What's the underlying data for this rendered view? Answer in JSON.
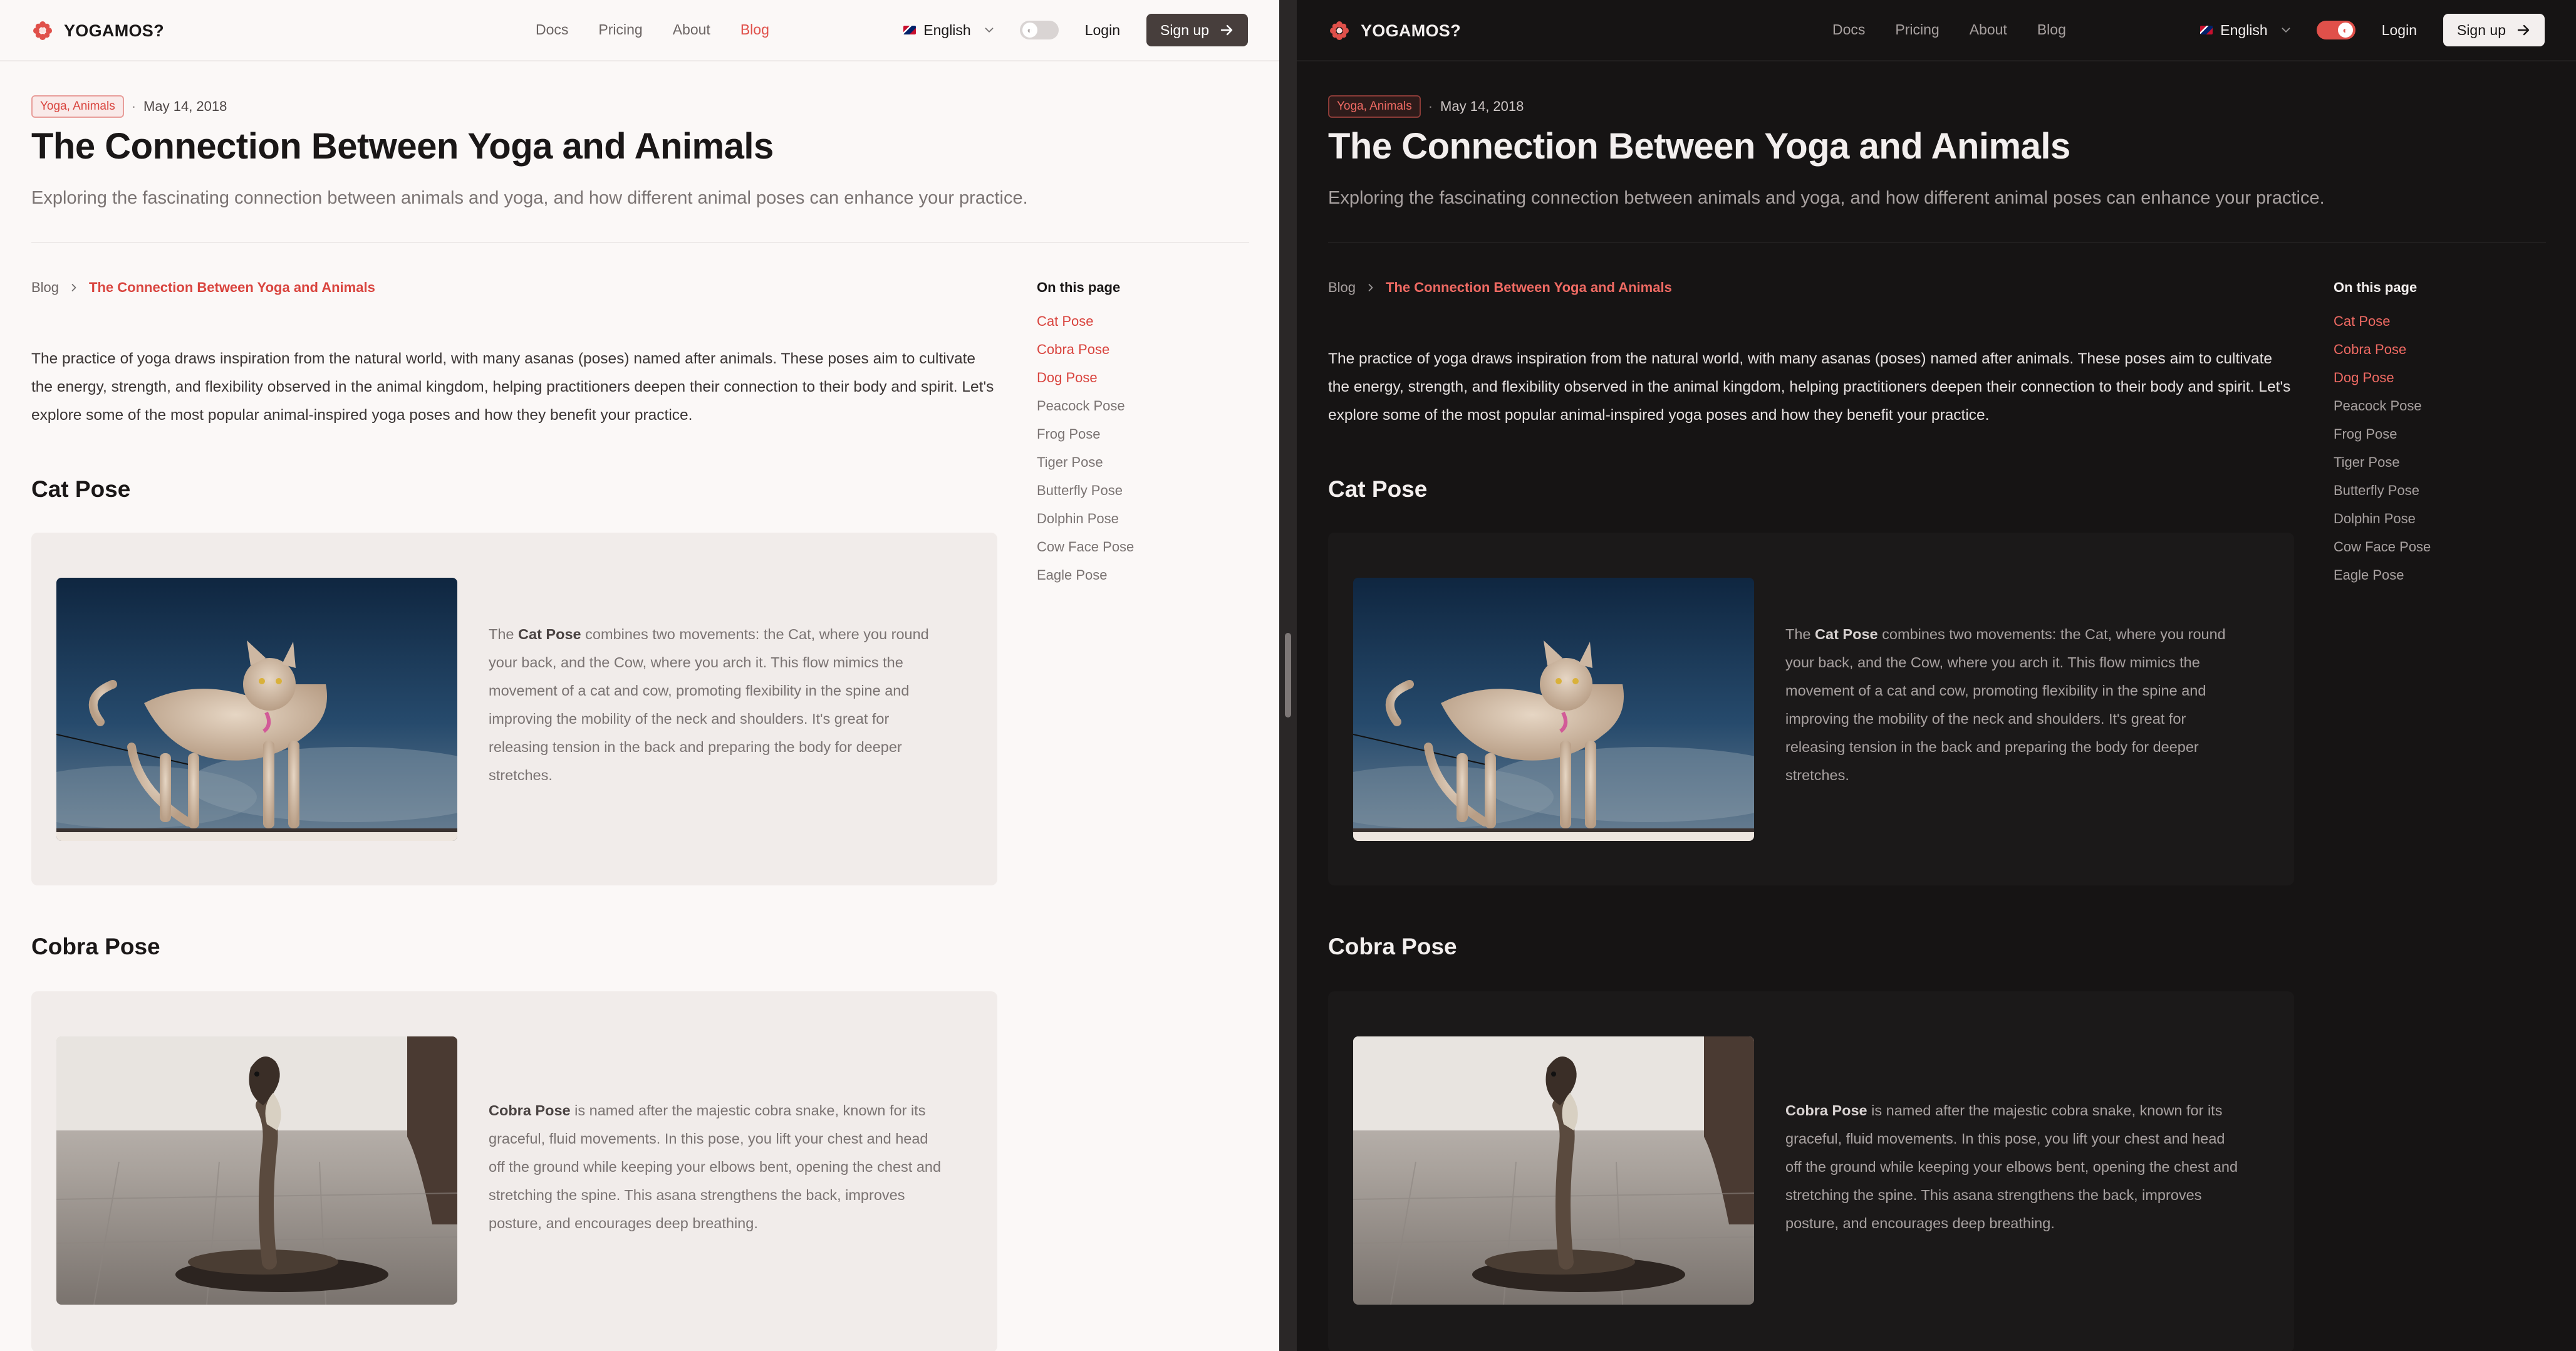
{
  "nav": {
    "brand": "YOGAMOS?",
    "links": [
      "Docs",
      "Pricing",
      "About",
      "Blog"
    ],
    "language": "English",
    "login": "Login",
    "signup": "Sign up"
  },
  "article": {
    "tags": "Yoga, Animals",
    "separator": "·",
    "date": "May 14, 2018",
    "title": "The Connection Between Yoga and Animals",
    "subtitle": "Exploring the fascinating connection between animals and yoga, and how different animal poses can enhance your practice.",
    "intro": "The practice of yoga draws inspiration from the natural world, with many asanas (poses) named after animals. These poses aim to cultivate the energy, strength, and flexibility observed in the animal kingdom, helping practitioners deepen their connection to their body and spirit. Let's explore some of the most popular animal-inspired yoga poses and how they benefit your practice."
  },
  "breadcrumb": {
    "root": "Blog",
    "current": "The Connection Between Yoga and Animals"
  },
  "sections": [
    {
      "title": "Cat Pose",
      "before": "The ",
      "bold": "Cat Pose",
      "after": " combines two movements: the Cat, where you round your back, and the Cow, where you arch it. This flow mimics the movement of a cat and cow, promoting flexibility in the spine and improving the mobility of the neck and shoulders. It's great for releasing tension in the back and preparing the body for deeper stretches.",
      "image": "cat-photo"
    },
    {
      "title": "Cobra Pose",
      "before": "",
      "bold": "Cobra Pose",
      "after": " is named after the majestic cobra snake, known for its graceful, fluid movements. In this pose, you lift your chest and head off the ground while keeping your elbows bent, opening the chest and stretching the spine. This asana strengthens the back, improves posture, and encourages deep breathing.",
      "image": "cobra-photo"
    }
  ],
  "toc": {
    "heading": "On this page",
    "items": [
      "Cat Pose",
      "Cobra Pose",
      "Dog Pose",
      "Peacock Pose",
      "Frog Pose",
      "Tiger Pose",
      "Butterfly Pose",
      "Dolphin Pose",
      "Cow Face Pose",
      "Eagle Pose"
    ],
    "active_count": 3
  },
  "theme": {
    "light_mode_pane": "light",
    "dark_mode_pane": "dark",
    "accent": "#e0504a",
    "light_bg": "#fbf8f7",
    "dark_bg": "#161414"
  },
  "icons": [
    "logo-flower-icon",
    "flag-icon",
    "chevron-down-icon",
    "theme-toggle-icon",
    "arrow-right-icon",
    "breadcrumb-chevron-icon"
  ]
}
